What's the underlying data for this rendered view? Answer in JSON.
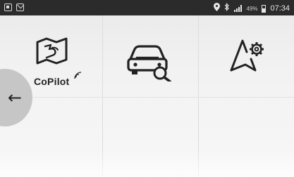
{
  "status_bar": {
    "time": "07:34",
    "battery_percent": "49%",
    "left_icons": [
      "notification-icon",
      "mail-icon"
    ],
    "right_icons": [
      "location-icon",
      "bluetooth-icon",
      "signal-icon",
      "battery-icon"
    ]
  },
  "tiles": [
    {
      "id": "copilot",
      "label": "CoPilot",
      "icon": "copilot-map-icon"
    },
    {
      "id": "vehicle",
      "icon": "vehicle-search-icon"
    },
    {
      "id": "nav-settings",
      "icon": "navigation-settings-icon"
    }
  ],
  "back_button": {
    "icon": "arrow-left-icon",
    "glyph": "←"
  }
}
